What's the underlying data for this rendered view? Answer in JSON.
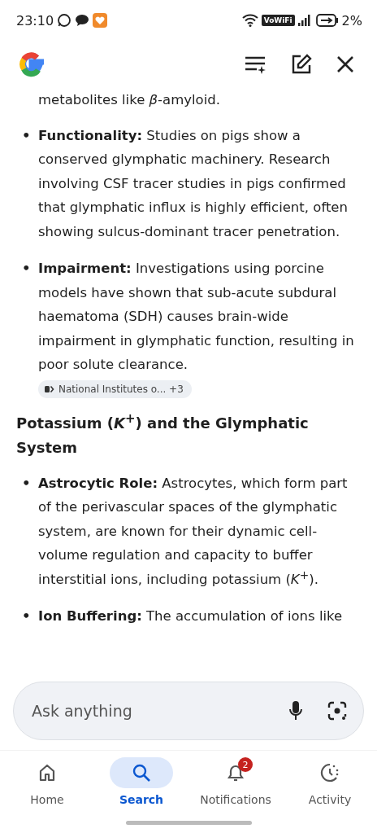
{
  "status_bar": {
    "time": "23:10",
    "wifi_label": "VoWiFi",
    "battery": "2%"
  },
  "content": {
    "intro": "metabolites like *β*-amyloid.",
    "bullets_1": [
      {
        "marker": "•",
        "text": "**Functionality:** Studies on pigs show a conserved glymphatic machinery. Research involving CSF tracer studies in pigs confirmed that glymphatic influx is highly efficient, often showing sulcus-dominant tracer penetration."
      },
      {
        "marker": "•",
        "text": "**Impairment:** Investigations using porcine models have shown that sub-acute subdural haematoma (SDH) causes brain-wide impairment in glymphatic function, resulting in poor solute clearance.",
        "source_chip": "National Institutes o... +3"
      }
    ],
    "heading": "Potassium (*K*$^{+}$) and the Glymphatic System",
    "bullets_2": [
      {
        "marker": "•",
        "text": "**Astrocytic Role:** Astrocytes, which form part of the perivascular spaces of the glymphatic system, are known for their dynamic cell-volume regulation and capacity to buffer interstitial ions, including potassium (*K*$^{+}$)."
      },
      {
        "marker": "•",
        "text": "**Ion Buffering:** The accumulation of ions like"
      }
    ]
  },
  "search": {
    "placeholder": "Ask anything"
  },
  "nav": [
    {
      "label": "Home",
      "selected": false
    },
    {
      "label": "Search",
      "selected": true
    },
    {
      "label": "Notifications",
      "selected": false,
      "badge": "2"
    },
    {
      "label": "Activity",
      "selected": false
    }
  ]
}
